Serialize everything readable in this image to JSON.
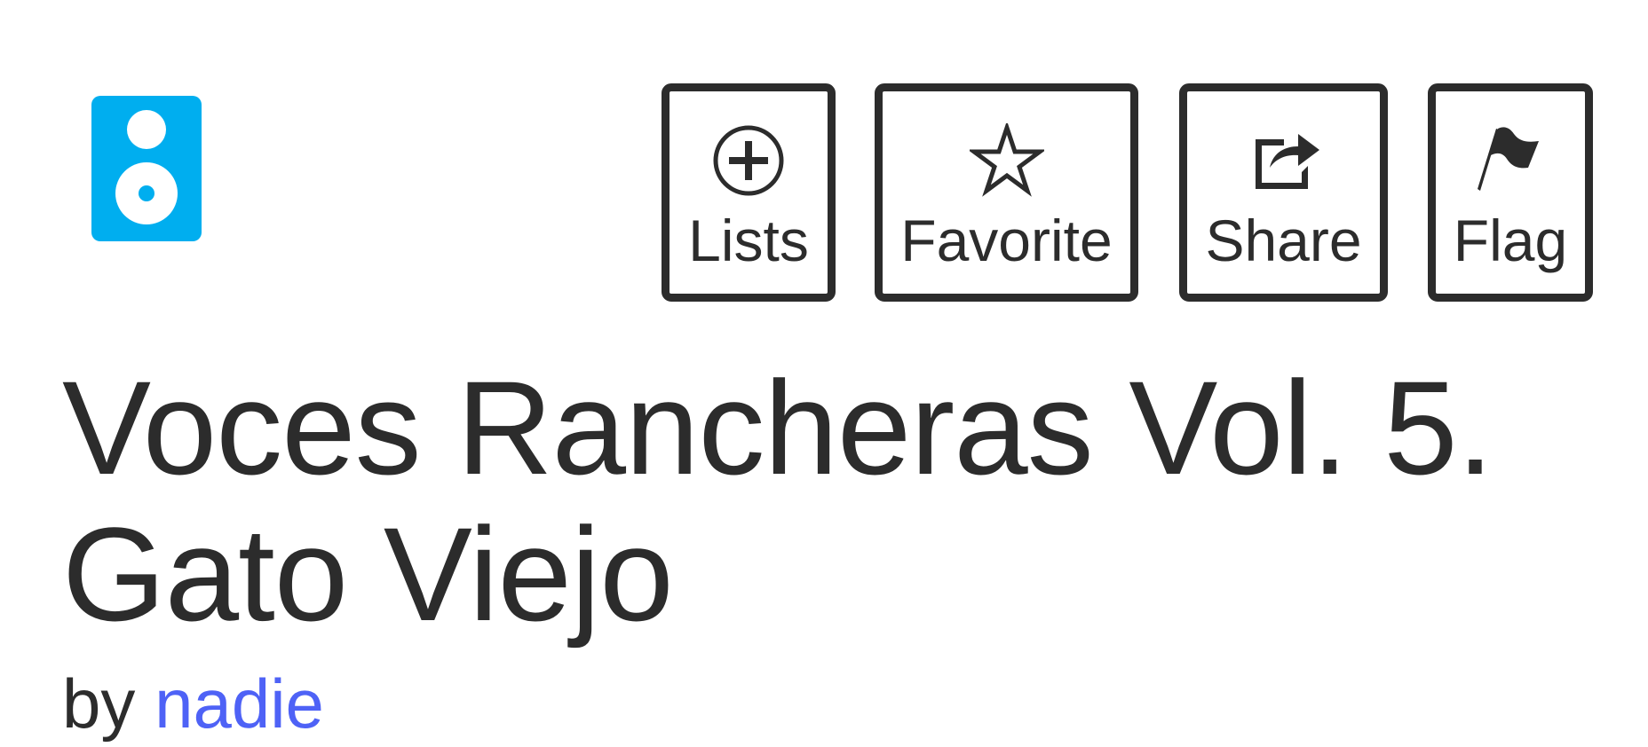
{
  "colors": {
    "accent_icon": "#00aeef",
    "text": "#2c2c2c",
    "link": "#4e62f6"
  },
  "media_icon": "speaker-icon",
  "actions": [
    {
      "label": "Lists",
      "icon": "plus-circle-icon"
    },
    {
      "label": "Favorite",
      "icon": "star-icon"
    },
    {
      "label": "Share",
      "icon": "share-icon"
    },
    {
      "label": "Flag",
      "icon": "flag-icon"
    }
  ],
  "item": {
    "title_line1": "Voces Rancheras Vol. 5.",
    "title_line2": "Gato Viejo",
    "by_prefix": "by",
    "author": "nadie"
  }
}
